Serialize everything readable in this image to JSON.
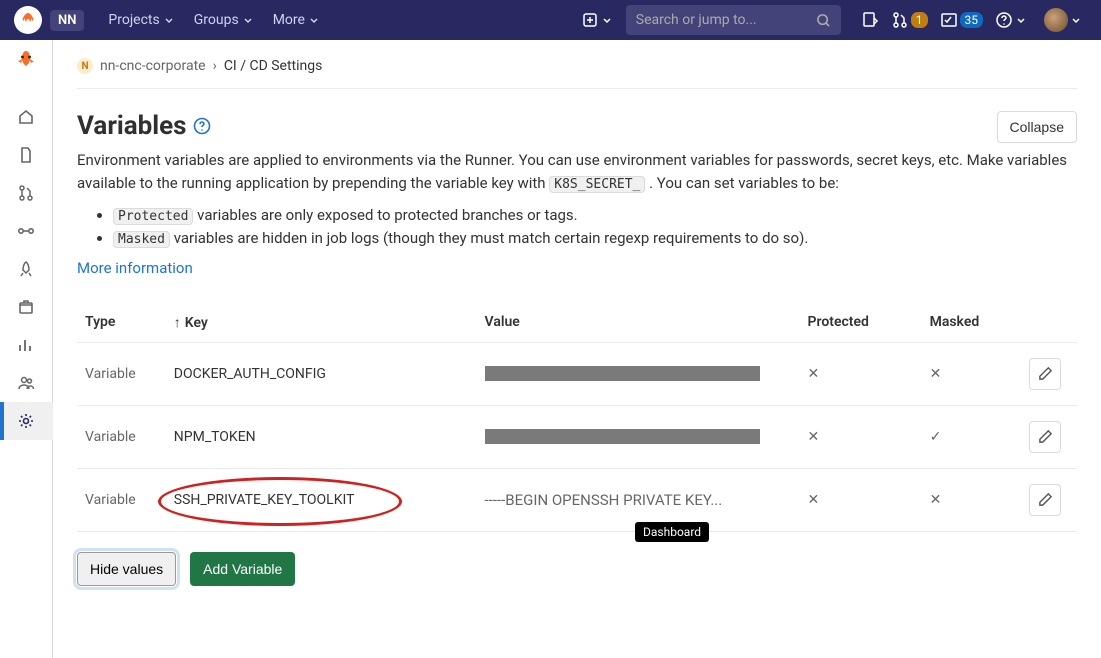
{
  "topbar": {
    "nn_badge": "NN",
    "nav": {
      "projects": "Projects",
      "groups": "Groups",
      "more": "More"
    },
    "search_placeholder": "Search or jump to...",
    "mr_badge": "1",
    "todo_badge": "35"
  },
  "breadcrumb": {
    "project": "nn-cnc-corporate",
    "current": "CI / CD Settings"
  },
  "section": {
    "title": "Variables",
    "collapse": "Collapse",
    "desc_pre": "Environment variables are applied to environments via the Runner. You can use environment variables for passwords, secret keys, etc. Make variables available to the running application by prepending the variable key with ",
    "desc_code": "K8S_SECRET_",
    "desc_post": " . You can set variables to be:",
    "bullet_protected_code": "Protected",
    "bullet_protected_text": " variables are only exposed to protected branches or tags.",
    "bullet_masked_code": "Masked",
    "bullet_masked_text": " variables are hidden in job logs (though they must match certain regexp requirements to do so).",
    "more_info": "More information"
  },
  "table": {
    "headers": {
      "type": "Type",
      "key": "Key",
      "value": "Value",
      "protected": "Protected",
      "masked": "Masked"
    },
    "rows": [
      {
        "type": "Variable",
        "key": "DOCKER_AUTH_CONFIG",
        "value_text": "",
        "protected": false,
        "masked": false
      },
      {
        "type": "Variable",
        "key": "NPM_TOKEN",
        "value_text": "",
        "protected": false,
        "masked": true
      },
      {
        "type": "Variable",
        "key": "SSH_PRIVATE_KEY_TOOLKIT",
        "value_text": "-----BEGIN OPENSSH PRIVATE KEY...",
        "protected": false,
        "masked": false
      }
    ]
  },
  "buttons": {
    "hide_values": "Hide values",
    "add_variable": "Add Variable"
  },
  "tooltip": "Dashboard"
}
